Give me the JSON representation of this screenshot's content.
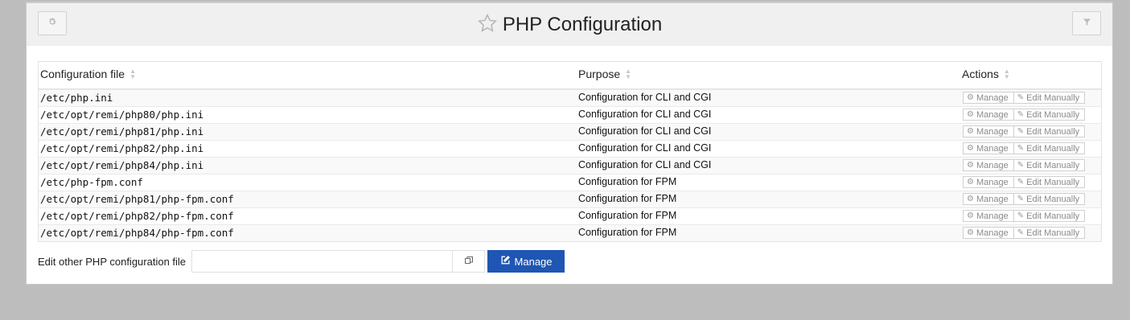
{
  "header": {
    "title": "PHP Configuration",
    "settings_icon": "gear-icon",
    "favorite_icon": "star-outline-icon",
    "filter_icon": "filter-icon"
  },
  "table": {
    "columns": [
      "Configuration file",
      "Purpose",
      "Actions"
    ],
    "rows": [
      {
        "file": "/etc/php.ini",
        "purpose": "Configuration for CLI and CGI"
      },
      {
        "file": "/etc/opt/remi/php80/php.ini",
        "purpose": "Configuration for CLI and CGI"
      },
      {
        "file": "/etc/opt/remi/php81/php.ini",
        "purpose": "Configuration for CLI and CGI"
      },
      {
        "file": "/etc/opt/remi/php82/php.ini",
        "purpose": "Configuration for CLI and CGI"
      },
      {
        "file": "/etc/opt/remi/php84/php.ini",
        "purpose": "Configuration for CLI and CGI"
      },
      {
        "file": "/etc/php-fpm.conf",
        "purpose": "Configuration for FPM"
      },
      {
        "file": "/etc/opt/remi/php81/php-fpm.conf",
        "purpose": "Configuration for FPM"
      },
      {
        "file": "/etc/opt/remi/php82/php-fpm.conf",
        "purpose": "Configuration for FPM"
      },
      {
        "file": "/etc/opt/remi/php84/php-fpm.conf",
        "purpose": "Configuration for FPM"
      }
    ],
    "manage_label": "Manage",
    "edit_manually_label": "Edit Manually"
  },
  "edit_other": {
    "label": "Edit other PHP configuration file",
    "value": "",
    "button_label": "Manage"
  },
  "colors": {
    "primary": "#1f56b3",
    "background": "#bdbdbd"
  }
}
